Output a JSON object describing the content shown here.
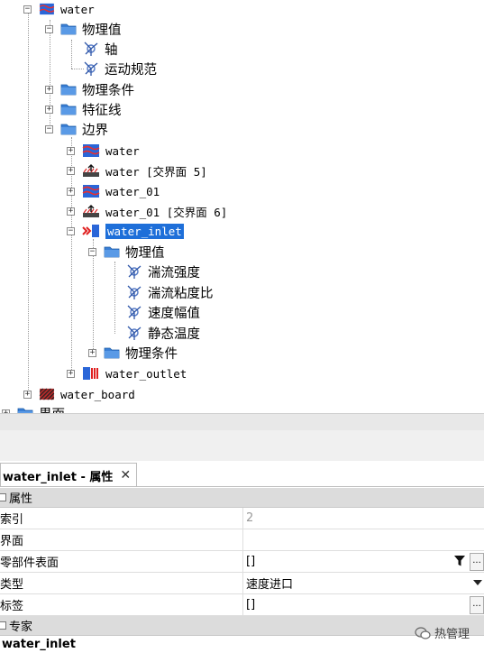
{
  "tree": {
    "water_root": "water",
    "physics_values": "物理值",
    "axis": "轴",
    "motion_spec": "运动规范",
    "physics_conditions": "物理条件",
    "feature_lines": "特征线",
    "boundaries": "边界",
    "b_water": "water",
    "b_water_interface": "water [交界面 5]",
    "b_water_01": "water_01",
    "b_water_01_interface": "water_01 [交界面 6]",
    "b_water_inlet": "water_inlet",
    "inlet_physics_values": "物理值",
    "turb_intensity": "湍流强度",
    "turb_viscosity_ratio": "湍流粘度比",
    "velocity_magnitude": "速度幅值",
    "static_temperature": "静态温度",
    "inlet_physics_conditions": "物理条件",
    "b_water_outlet": "water_outlet",
    "water_board": "water_board",
    "interface_partial": "界面"
  },
  "panel": {
    "tab_title": "water_inlet - 属性",
    "close_glyph": "✕",
    "category_properties": "属性",
    "rows": [
      {
        "name": "索引",
        "value": "2"
      },
      {
        "name": "界面",
        "value": ""
      },
      {
        "name": "零部件表面",
        "value": "[]"
      },
      {
        "name": "类型",
        "value": "速度进口"
      },
      {
        "name": "标签",
        "value": "[]"
      }
    ],
    "category_expert": "专家",
    "footer_title": "water_inlet",
    "dots": "..."
  },
  "watermark": {
    "text": "热管理"
  },
  "colors": {
    "selection": "#1e6fd9",
    "folder": "#3a7fd5"
  }
}
